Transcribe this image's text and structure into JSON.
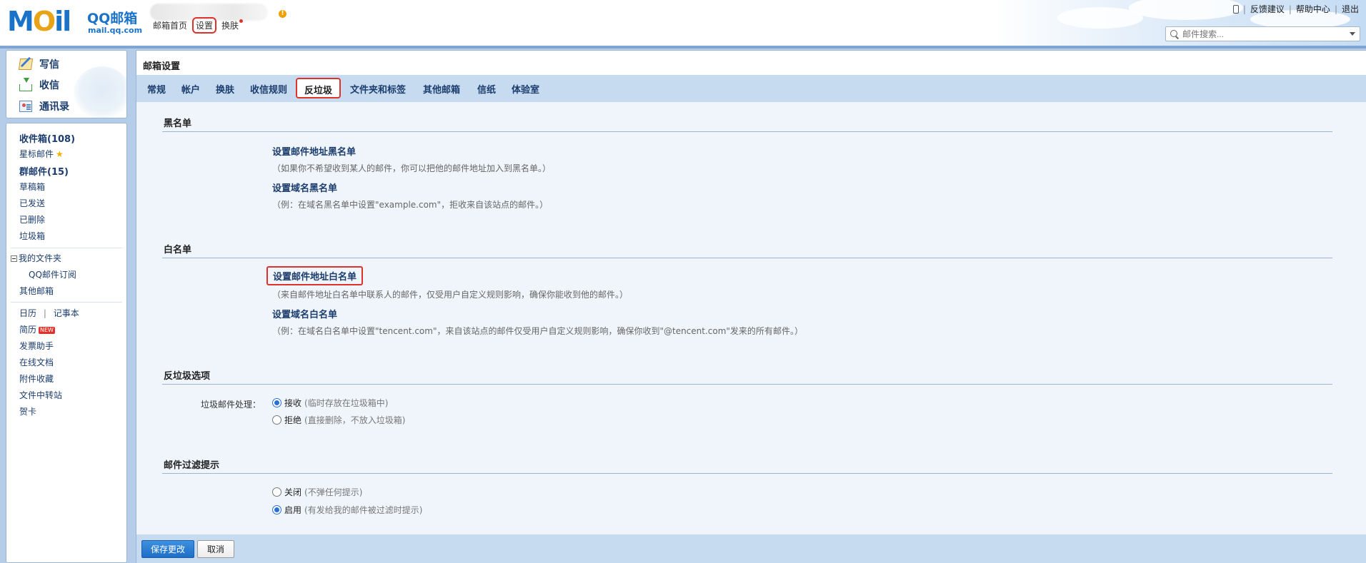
{
  "header": {
    "logo_moil_m": "M",
    "logo_moil_o": "O",
    "logo_moil_il": "il",
    "logo_brand": "QQ邮箱",
    "logo_domain": "mail.qq.com",
    "nav": {
      "home": "邮箱首页",
      "settings": "设置",
      "skin": "换肤"
    },
    "links": {
      "feedback": "反馈建议",
      "help": "帮助中心",
      "logout": "退出",
      "separator": "|"
    },
    "search": {
      "placeholder": "邮件搜索..."
    },
    "notice_dot": "!"
  },
  "sidebar": {
    "compose": "写信",
    "receive": "收信",
    "contacts": "通讯录",
    "inbox": "收件箱(108)",
    "starred": "星标邮件",
    "group": "群邮件(15)",
    "drafts": "草稿箱",
    "sent": "已发送",
    "deleted": "已删除",
    "spam": "垃圾箱",
    "my_folders": "我的文件夹",
    "qq_subscription": "QQ邮件订阅",
    "other_mailboxes": "其他邮箱",
    "calendar": "日历",
    "calendar_sep": "|",
    "notes": "记事本",
    "resume": "简历",
    "new_badge": "NEW",
    "invoice": "发票助手",
    "docs": "在线文档",
    "attachments": "附件收藏",
    "transfer": "文件中转站",
    "cards": "贺卡"
  },
  "main": {
    "title": "邮箱设置",
    "tabs": {
      "general": "常规",
      "account": "帐户",
      "skin": "换肤",
      "rules": "收信规则",
      "antispam": "反垃圾",
      "folders": "文件夹和标签",
      "other": "其他邮箱",
      "paper": "信纸",
      "lab": "体验室"
    },
    "blacklist": {
      "title": "黑名单",
      "address_link": "设置邮件地址黑名单",
      "address_desc": "（如果你不希望收到某人的邮件，你可以把他的邮件地址加入到黑名单。）",
      "domain_link": "设置域名黑名单",
      "domain_desc": "（例：在域名黑名单中设置\"example.com\"，拒收来自该站点的邮件。）"
    },
    "whitelist": {
      "title": "白名单",
      "address_link": "设置邮件地址白名单",
      "address_desc": "（来自邮件地址白名单中联系人的邮件，仅受用户自定义规则影响，确保你能收到他的邮件。）",
      "domain_link": "设置域名白名单",
      "domain_desc": "（例：在域名白名单中设置\"tencent.com\"，来自该站点的邮件仅受用户自定义规则影响，确保你收到\"@tencent.com\"发来的所有邮件。）"
    },
    "antispam_options": {
      "title": "反垃圾选项",
      "label": "垃圾邮件处理：",
      "accept": "接收",
      "accept_hint": "(临时存放在垃圾箱中)",
      "accept_selected": true,
      "reject": "拒绝",
      "reject_hint": "(直接删除，不放入垃圾箱)",
      "reject_selected": false
    },
    "filter_notice": {
      "title": "邮件过滤提示",
      "off": "关闭",
      "off_hint": "(不弹任何提示)",
      "off_selected": false,
      "on": "启用",
      "on_hint": "(有发给我的邮件被过滤时提示)",
      "on_selected": true
    },
    "buttons": {
      "save": "保存更改",
      "cancel": "取消"
    }
  },
  "colors": {
    "accent": "#1e6fc6",
    "highlight": "#e0322c",
    "tab_bar": "#c7dbf0",
    "panel_bg": "#f0f5fb",
    "link": "#1b3d6d"
  }
}
